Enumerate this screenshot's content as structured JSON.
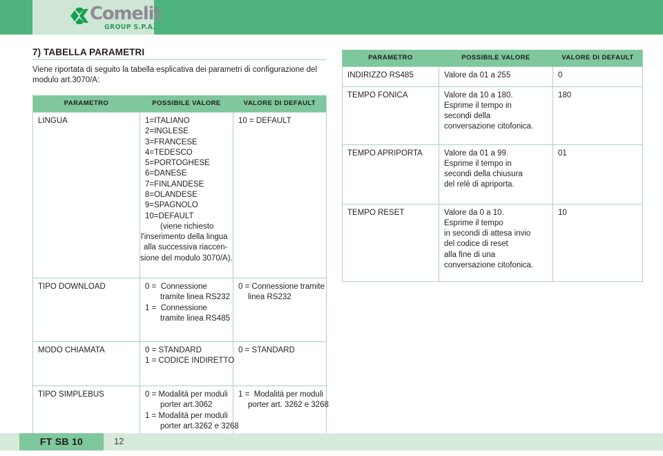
{
  "header": {
    "logo_word": "Comelit",
    "logo_registered": "®",
    "logo_sub": "GROUP S.P.A.",
    "brand_green": "#4eb37c",
    "logo_panel_green": "#cfe6d6",
    "logo_word_gray": "#8c8c92"
  },
  "section": {
    "title": "7) TABELLA PARAMETRI",
    "intro": "Viene riportata di seguito la tabella esplicativa dei parametri di configurazione del modulo art.3070/A:"
  },
  "table_headers": {
    "parametro": "PARAMETRO",
    "possibile_valore": "POSSIBILE VALORE",
    "valore_di_default": "VALORE DI DEFAULT"
  },
  "left_table": {
    "rows": [
      {
        "parametro": "LINGUA",
        "possibile_valore_lines": [
          "1=ITALIANO",
          "2=INGLESE",
          "3=FRANCESE",
          "4=TEDESCO",
          "5=PORTOGHESE",
          "6=DANESE",
          "7=FINLANDESE",
          "8=OLANDESE",
          "9=SPAGNOLO",
          "10=DEFAULT",
          "(viene richiesto",
          "l'inserimento della lingua",
          "alla successiva riaccen-",
          "sione del modulo 3070/A)."
        ],
        "valore_di_default_lines": [
          "10 = DEFAULT"
        ]
      },
      {
        "parametro": "TIPO DOWNLOAD",
        "possibile_valore_lines": [
          "0 =  Connessione",
          "tramite linea RS232",
          "1 =  Connessione",
          "tramite linea RS485"
        ],
        "valore_di_default_lines": [
          "0 = Connessione tramite",
          "linea RS232"
        ]
      },
      {
        "parametro": "MODO CHIAMATA",
        "possibile_valore_lines": [
          "0 = STANDARD",
          "1 = CODICE INDIRETTO"
        ],
        "valore_di_default_lines": [
          "0 = STANDARD"
        ]
      },
      {
        "parametro": "TIPO SIMPLEBUS",
        "possibile_valore_lines": [
          "0 = Modalità per moduli",
          "porter art.3062",
          "1 = Modalità per moduli",
          "porter art.3262 e 3268"
        ],
        "valore_di_default_lines": [
          "1 =  Modalità per moduli",
          "porter art. 3262 e 3268"
        ]
      }
    ]
  },
  "right_table": {
    "rows": [
      {
        "parametro": "INDIRIZZO RS485",
        "possibile_valore_lines": [
          "Valore da 01 a 255"
        ],
        "valore_di_default_lines": [
          "0"
        ]
      },
      {
        "parametro": "TEMPO FONICA",
        "possibile_valore_lines": [
          "Valore da 10 a 180.",
          "Esprime il tempo in",
          "secondi della",
          "conversazione citofonica."
        ],
        "valore_di_default_lines": [
          "180"
        ]
      },
      {
        "parametro": "TEMPO APRIPORTA",
        "possibile_valore_lines": [
          "Valore da 01 a 99.",
          "Esprime il tempo in",
          "secondi della chiusura",
          "del relè di apriporta."
        ],
        "valore_di_default_lines": [
          "01"
        ]
      },
      {
        "parametro": "TEMPO RESET",
        "possibile_valore_lines": [
          "Valore da 0 a 10.",
          "Esprime il tempo",
          "in secondi di attesa invio",
          "del codice di reset",
          "alla fine di una",
          "conversazione citofonica."
        ],
        "valore_di_default_lines": [
          "10"
        ]
      }
    ]
  },
  "footer": {
    "doc_code": "FT SB 10",
    "page_number": "12",
    "tag_green": "#7fc79d",
    "band_green": "#d7ead9"
  }
}
